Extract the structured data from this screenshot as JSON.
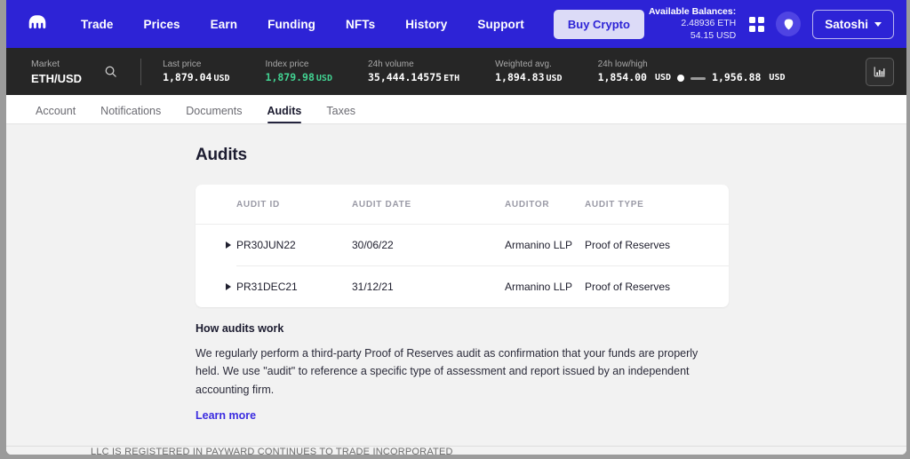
{
  "topnav": {
    "logo_name": "kraken-logo",
    "links": [
      {
        "label": "Trade"
      },
      {
        "label": "Prices"
      },
      {
        "label": "Earn"
      },
      {
        "label": "Funding"
      },
      {
        "label": "NFTs"
      },
      {
        "label": "History"
      },
      {
        "label": "Support"
      }
    ],
    "buy_crypto_label": "Buy Crypto",
    "balances": {
      "title": "Available Balances:",
      "eth": "2.48936 ETH",
      "usd": "54.15 USD"
    },
    "user_label": "Satoshi",
    "colors": {
      "nav_bg": "#2d23d6",
      "buy_btn_bg": "#dcdbf7",
      "buy_btn_text": "#2d23d6"
    }
  },
  "ticker": {
    "market_label": "Market",
    "market_value": "ETH/USD",
    "stats": [
      {
        "label": "Last price",
        "value": "1,879.04",
        "unit": "USD",
        "green": false
      },
      {
        "label": "Index price",
        "value": "1,879.98",
        "unit": "USD",
        "green": true
      },
      {
        "label": "24h volume",
        "value": "35,444.14575",
        "unit": "ETH",
        "green": false
      },
      {
        "label": "Weighted avg.",
        "value": "1,894.83",
        "unit": "USD",
        "green": false
      }
    ],
    "lowhigh": {
      "label": "24h low/high",
      "low": "1,854.00",
      "low_unit": "USD",
      "high": "1,956.88",
      "high_unit": "USD"
    },
    "colors": {
      "bar_bg": "#262626",
      "green": "#42d392"
    }
  },
  "subtabs": {
    "items": [
      {
        "label": "Account",
        "active": false
      },
      {
        "label": "Notifications",
        "active": false
      },
      {
        "label": "Documents",
        "active": false
      },
      {
        "label": "Audits",
        "active": true
      },
      {
        "label": "Taxes",
        "active": false
      }
    ]
  },
  "main": {
    "page_title": "Audits",
    "table": {
      "headers": [
        "AUDIT ID",
        "AUDIT DATE",
        "AUDITOR",
        "AUDIT TYPE"
      ],
      "rows": [
        {
          "id": "PR30JUN22",
          "date": "30/06/22",
          "auditor": "Armanino LLP",
          "type": "Proof of Reserves"
        },
        {
          "id": "PR31DEC21",
          "date": "31/12/21",
          "auditor": "Armanino LLP",
          "type": "Proof of Reserves"
        }
      ]
    },
    "info": {
      "heading": "How audits work",
      "body": "We regularly perform a third-party Proof of Reserves audit as confirmation that your funds are properly held. We use \"audit\" to reference a specific type of assessment and report issued by an independent accounting firm.",
      "link_label": "Learn more",
      "link_color": "#3b2ce0"
    }
  },
  "footer": {
    "text": "LLC IS REGISTERED IN PAYWARD CONTINUES TO TRADE INCORPORATED"
  }
}
